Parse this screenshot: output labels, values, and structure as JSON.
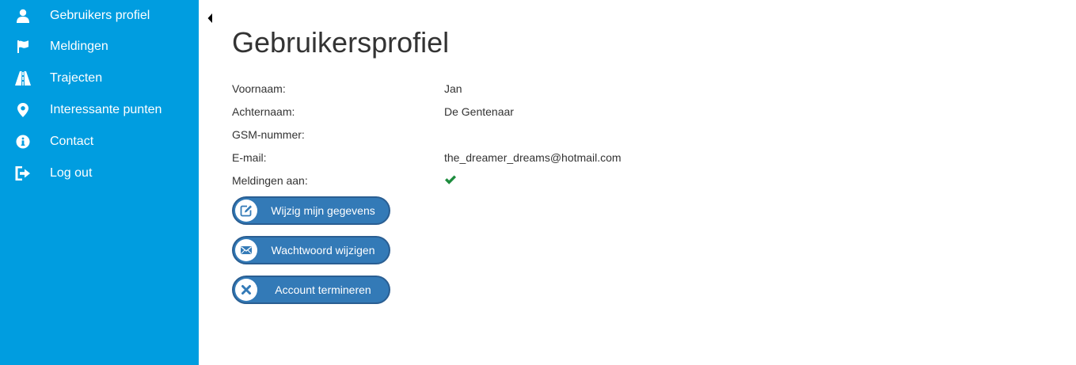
{
  "sidebar": {
    "background": "#009de0",
    "items": [
      {
        "label": "Gebruikers profiel",
        "icon": "user-icon"
      },
      {
        "label": "Meldingen",
        "icon": "flag-icon"
      },
      {
        "label": "Trajecten",
        "icon": "road-icon"
      },
      {
        "label": "Interessante punten",
        "icon": "map-marker-icon"
      },
      {
        "label": "Contact",
        "icon": "info-icon"
      },
      {
        "label": "Log out",
        "icon": "logout-icon"
      }
    ]
  },
  "main": {
    "title": "Gebruikersprofiel",
    "fields": [
      {
        "label": "Voornaam:",
        "value": "Jan"
      },
      {
        "label": "Achternaam:",
        "value": "De Gentenaar"
      },
      {
        "label": "GSM-nummer:",
        "value": ""
      },
      {
        "label": "E-mail:",
        "value": "the_dreamer_dreams@hotmail.com"
      },
      {
        "label": "Meldingen aan:",
        "value": "checked",
        "icon": "check-icon"
      }
    ],
    "buttons": [
      {
        "label": "Wijzig mijn gegevens",
        "icon": "edit-icon"
      },
      {
        "label": "Wachtwoord wijzigen",
        "icon": "envelope-icon"
      },
      {
        "label": "Account termineren",
        "icon": "close-icon"
      }
    ]
  },
  "colors": {
    "button": "#337ab7",
    "check": "#1e8c3e",
    "text": "#333333"
  }
}
